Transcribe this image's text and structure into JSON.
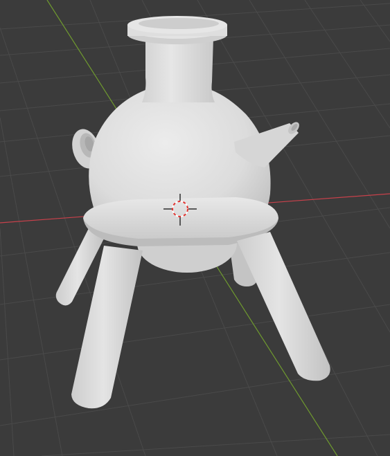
{
  "viewport": {
    "background": "#3b3b3b",
    "grid_color": "#4a4a4a",
    "x_axis_color": "#c8414b",
    "y_axis_color": "#6f9a2f",
    "model_color": "#d9d9d9",
    "cursor_ring_colors": [
      "#e0332f",
      "#ffffff"
    ],
    "cursor_cross_color": "#111111"
  },
  "scene": {
    "object": "flask-on-four-legged-stand",
    "parts": [
      "flask-neck",
      "flask-rim",
      "flask-body",
      "side-spout",
      "side-handle-ring",
      "stand-ring",
      "leg-front-left",
      "leg-front-right",
      "leg-back-left",
      "leg-back-right"
    ]
  }
}
